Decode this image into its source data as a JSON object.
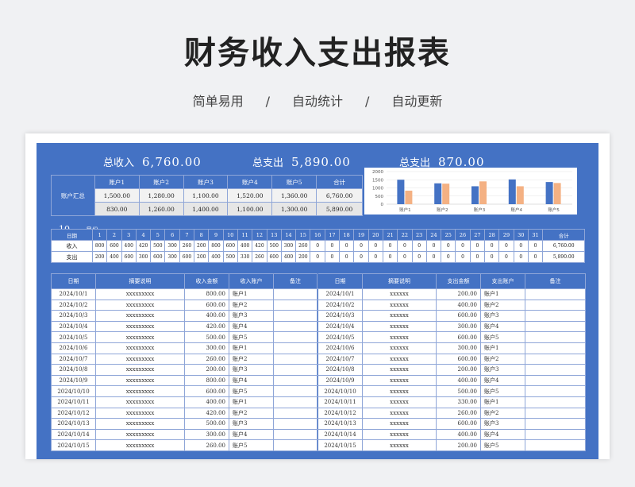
{
  "title": "财务收入支出报表",
  "subtitle": [
    "简单易用",
    "/",
    "自动统计",
    "/",
    "自动更新"
  ],
  "totals": {
    "income_label": "总收入",
    "income_value": "6,760.00",
    "expense_label": "总支出",
    "expense_value": "5,890.00",
    "balance_label": "总支出",
    "balance_value": "870.00"
  },
  "accounts": {
    "row_label": "账户汇总",
    "headers": [
      "账户1",
      "账户2",
      "账户3",
      "账户4",
      "账户5",
      "合计"
    ],
    "income": [
      "1,500.00",
      "1,280.00",
      "1,100.00",
      "1,520.00",
      "1,360.00",
      "6,760.00"
    ],
    "expense": [
      "830.00",
      "1,260.00",
      "1,400.00",
      "1,100.00",
      "1,300.00",
      "5,890.00"
    ]
  },
  "colors": {
    "panel": "#4472c4",
    "income_bar": "#4472c4",
    "expense_bar": "#f4b183"
  },
  "chart_data": {
    "type": "bar",
    "categories": [
      "账户1",
      "账户2",
      "账户3",
      "账户4",
      "账户5"
    ],
    "series": [
      {
        "values": [
          1500,
          1280,
          1100,
          1520,
          1360
        ]
      },
      {
        "values": [
          830,
          1260,
          1400,
          1100,
          1300
        ]
      }
    ],
    "ylim": [
      0,
      2000
    ],
    "yticks": [
      "2000",
      "1500",
      "1000",
      "500",
      "0"
    ],
    "grid": true
  },
  "month": {
    "number": "10",
    "label": "月份"
  },
  "daily": {
    "date_label": "日期",
    "days": [
      "1",
      "2",
      "3",
      "4",
      "5",
      "6",
      "7",
      "8",
      "9",
      "10",
      "11",
      "12",
      "13",
      "14",
      "15",
      "16",
      "17",
      "18",
      "19",
      "20",
      "21",
      "22",
      "23",
      "24",
      "25",
      "26",
      "27",
      "28",
      "29",
      "30",
      "31"
    ],
    "total_label": "合计",
    "income_label": "收入",
    "expense_label": "支出",
    "income": [
      "800",
      "600",
      "400",
      "420",
      "500",
      "300",
      "260",
      "200",
      "800",
      "600",
      "400",
      "420",
      "500",
      "300",
      "260",
      "0",
      "0",
      "0",
      "0",
      "0",
      "0",
      "0",
      "0",
      "0",
      "0",
      "0",
      "0",
      "0",
      "0",
      "0",
      "0"
    ],
    "expense": [
      "200",
      "400",
      "600",
      "300",
      "600",
      "300",
      "600",
      "200",
      "400",
      "500",
      "330",
      "260",
      "600",
      "400",
      "200",
      "0",
      "0",
      "0",
      "0",
      "0",
      "0",
      "0",
      "0",
      "0",
      "0",
      "0",
      "0",
      "0",
      "0",
      "0",
      "0"
    ],
    "income_total": "6,760.00",
    "expense_total": "5,890.00"
  },
  "detail": {
    "income_headers": [
      "日期",
      "摘要说明",
      "收入金额",
      "收入账户",
      "备注"
    ],
    "expense_headers": [
      "日期",
      "摘要说明",
      "支出金额",
      "支出账户",
      "备注"
    ],
    "income_rows": [
      [
        "2024/10/1",
        "xxxxxxxxx",
        "800.00",
        "账户1",
        ""
      ],
      [
        "2024/10/2",
        "xxxxxxxxx",
        "600.00",
        "账户2",
        ""
      ],
      [
        "2024/10/3",
        "xxxxxxxxx",
        "400.00",
        "账户3",
        ""
      ],
      [
        "2024/10/4",
        "xxxxxxxxx",
        "420.00",
        "账户4",
        ""
      ],
      [
        "2024/10/5",
        "xxxxxxxxx",
        "500.00",
        "账户5",
        ""
      ],
      [
        "2024/10/6",
        "xxxxxxxxx",
        "300.00",
        "账户1",
        ""
      ],
      [
        "2024/10/7",
        "xxxxxxxxx",
        "260.00",
        "账户2",
        ""
      ],
      [
        "2024/10/8",
        "xxxxxxxxx",
        "200.00",
        "账户3",
        ""
      ],
      [
        "2024/10/9",
        "xxxxxxxxx",
        "800.00",
        "账户4",
        ""
      ],
      [
        "2024/10/10",
        "xxxxxxxxx",
        "600.00",
        "账户5",
        ""
      ],
      [
        "2024/10/11",
        "xxxxxxxxx",
        "400.00",
        "账户1",
        ""
      ],
      [
        "2024/10/12",
        "xxxxxxxxx",
        "420.00",
        "账户2",
        ""
      ],
      [
        "2024/10/13",
        "xxxxxxxxx",
        "500.00",
        "账户3",
        ""
      ],
      [
        "2024/10/14",
        "xxxxxxxxx",
        "300.00",
        "账户4",
        ""
      ],
      [
        "2024/10/15",
        "xxxxxxxxx",
        "260.00",
        "账户5",
        ""
      ]
    ],
    "expense_rows": [
      [
        "2024/10/1",
        "xxxxxx",
        "200.00",
        "账户1",
        ""
      ],
      [
        "2024/10/2",
        "xxxxxx",
        "400.00",
        "账户2",
        ""
      ],
      [
        "2024/10/3",
        "xxxxxx",
        "600.00",
        "账户3",
        ""
      ],
      [
        "2024/10/4",
        "xxxxxx",
        "300.00",
        "账户4",
        ""
      ],
      [
        "2024/10/5",
        "xxxxxx",
        "600.00",
        "账户5",
        ""
      ],
      [
        "2024/10/6",
        "xxxxxx",
        "300.00",
        "账户1",
        ""
      ],
      [
        "2024/10/7",
        "xxxxxx",
        "600.00",
        "账户2",
        ""
      ],
      [
        "2024/10/8",
        "xxxxxx",
        "200.00",
        "账户3",
        ""
      ],
      [
        "2024/10/9",
        "xxxxxx",
        "400.00",
        "账户4",
        ""
      ],
      [
        "2024/10/10",
        "xxxxxx",
        "500.00",
        "账户5",
        ""
      ],
      [
        "2024/10/11",
        "xxxxxx",
        "330.00",
        "账户1",
        ""
      ],
      [
        "2024/10/12",
        "xxxxxx",
        "260.00",
        "账户2",
        ""
      ],
      [
        "2024/10/13",
        "xxxxxx",
        "600.00",
        "账户3",
        ""
      ],
      [
        "2024/10/14",
        "xxxxxx",
        "400.00",
        "账户4",
        ""
      ],
      [
        "2024/10/15",
        "xxxxxx",
        "200.00",
        "账户5",
        ""
      ]
    ]
  }
}
